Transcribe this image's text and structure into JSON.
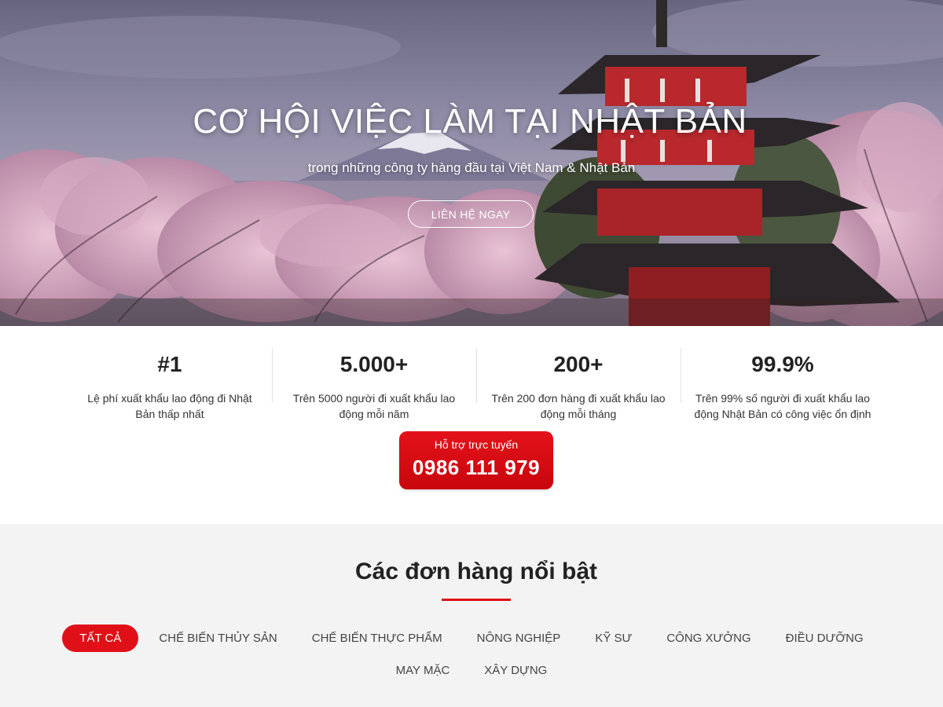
{
  "hero": {
    "title": "CƠ HỘI VIỆC LÀM TẠI NHẬT BẢN",
    "subtitle": "trong những công ty hàng đầu tại Việt Nam & Nhật Bản",
    "cta_label": "LIÊN HỆ NGAY"
  },
  "stats": [
    {
      "value": "#1",
      "description": "Lệ phí xuất khẩu lao động đi Nhật Bản thấp nhất"
    },
    {
      "value": "5.000+",
      "description": "Trên 5000 người đi xuất khẩu lao động mỗi năm"
    },
    {
      "value": "200+",
      "description": "Trên 200 đơn hàng đi xuất khẩu lao động mỗi tháng"
    },
    {
      "value": "99.9%",
      "description": "Trên 99% số người đi xuất khẩu lao động Nhật Bản có công việc ổn định"
    }
  ],
  "hotline": {
    "label": "Hỗ trợ trực tuyến",
    "phone": "0986 111 979"
  },
  "featured": {
    "title": "Các đơn hàng nổi bật",
    "tabs": [
      {
        "label": "TẤT CẢ",
        "active": true
      },
      {
        "label": "CHẾ BIẾN THỦY SẢN",
        "active": false
      },
      {
        "label": "CHẾ BIẾN THỰC PHẨM",
        "active": false
      },
      {
        "label": "NÔNG NGHIỆP",
        "active": false
      },
      {
        "label": "KỸ SƯ",
        "active": false
      },
      {
        "label": "CÔNG XƯỞNG",
        "active": false
      },
      {
        "label": "ĐIỀU DƯỠNG",
        "active": false
      },
      {
        "label": "MAY MẶC",
        "active": false
      },
      {
        "label": "XÂY DỰNG",
        "active": false
      }
    ]
  },
  "colors": {
    "accent": "#e01018",
    "section_bg": "#f3f3f3",
    "text_dark": "#222222"
  }
}
